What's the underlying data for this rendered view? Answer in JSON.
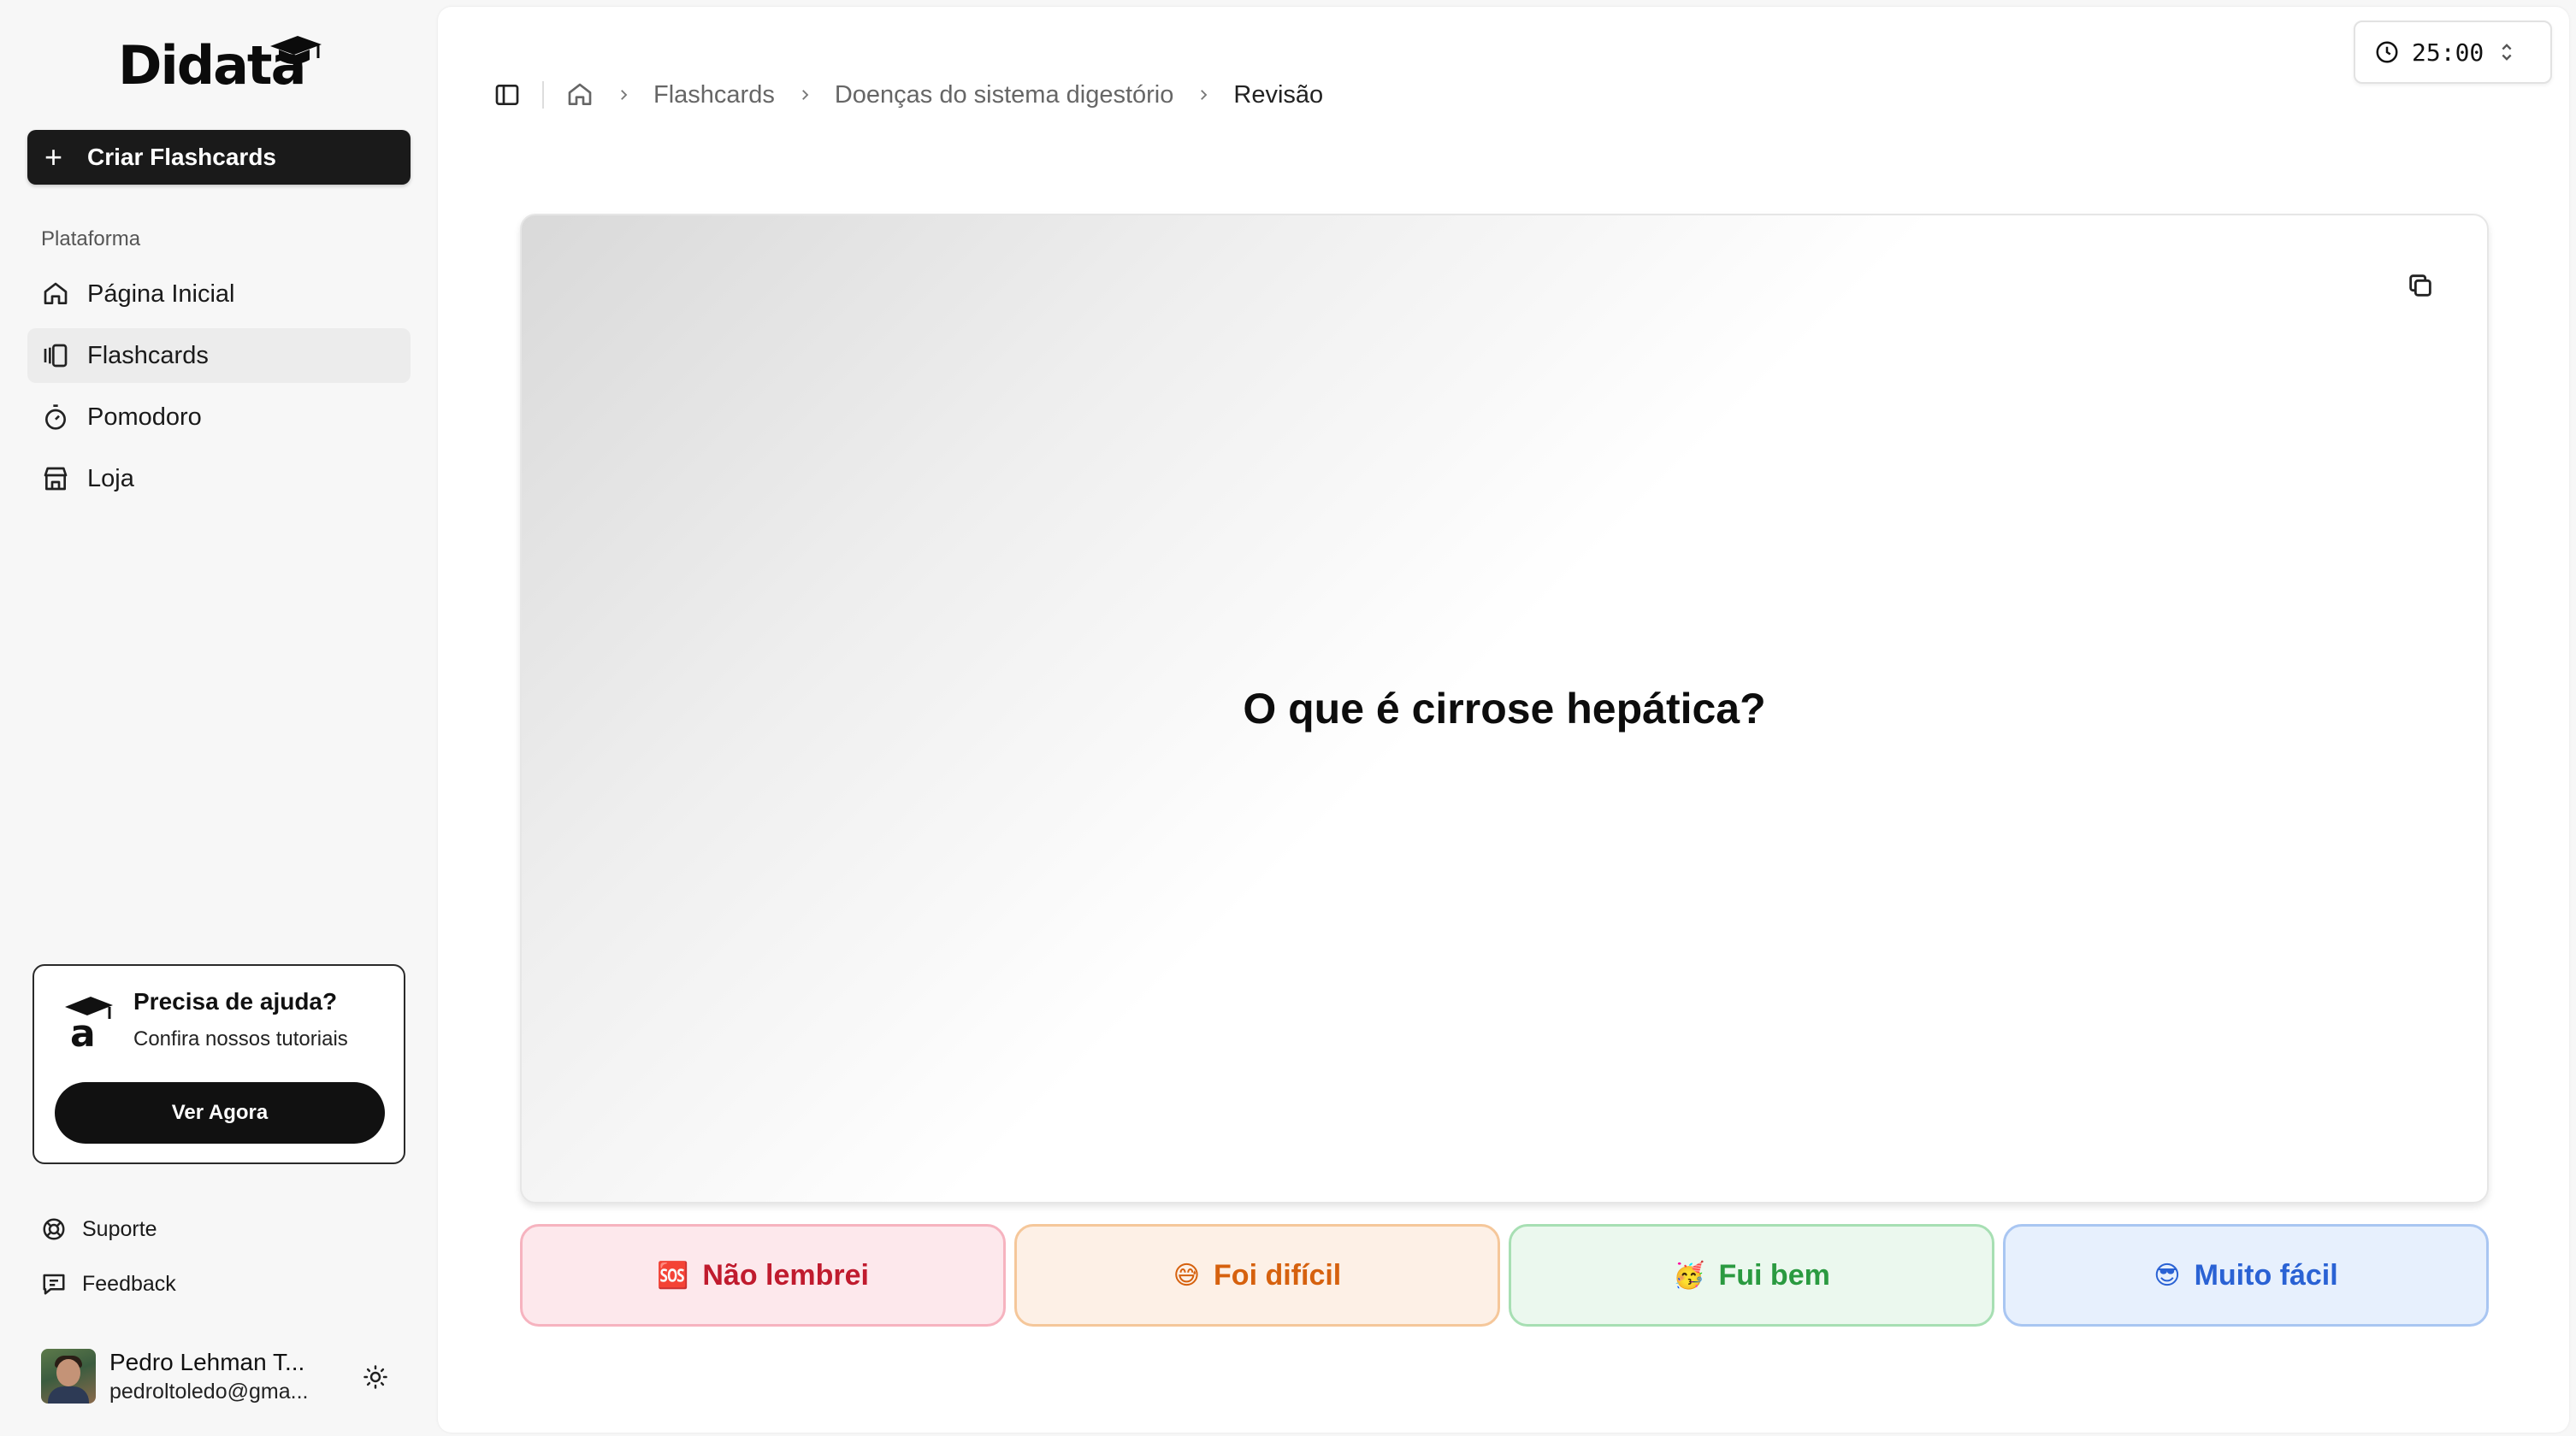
{
  "brand": {
    "name": "Didata"
  },
  "sidebar": {
    "create_label": "Criar Flashcards",
    "section_label": "Plataforma",
    "items": [
      {
        "label": "Página Inicial",
        "icon": "home-icon"
      },
      {
        "label": "Flashcards",
        "icon": "flashcards-icon",
        "active": true
      },
      {
        "label": "Pomodoro",
        "icon": "stopwatch-icon"
      },
      {
        "label": "Loja",
        "icon": "store-icon"
      }
    ],
    "help": {
      "title": "Precisa de ajuda?",
      "subtitle": "Confira nossos tutoriais",
      "button": "Ver Agora"
    },
    "footer_links": [
      {
        "label": "Suporte",
        "icon": "lifebuoy-icon"
      },
      {
        "label": "Feedback",
        "icon": "message-icon"
      }
    ],
    "user": {
      "name": "Pedro Lehman T...",
      "email": "pedroltoledo@gma..."
    }
  },
  "breadcrumb": [
    "Flashcards",
    "Doenças do sistema digestório",
    "Revisão"
  ],
  "timer": {
    "value": "25:00"
  },
  "card": {
    "question": "O que é cirrose hepática?"
  },
  "answers": [
    {
      "emoji": "🆘",
      "label": "Não lembrei",
      "color": "#c01b2e"
    },
    {
      "emoji": "😅",
      "label": "Foi difícil",
      "color": "#d6610e"
    },
    {
      "emoji": "🥳",
      "label": "Fui bem",
      "color": "#2a9a40"
    },
    {
      "emoji": "😎",
      "label": "Muito fácil",
      "color": "#2a62d4"
    }
  ]
}
